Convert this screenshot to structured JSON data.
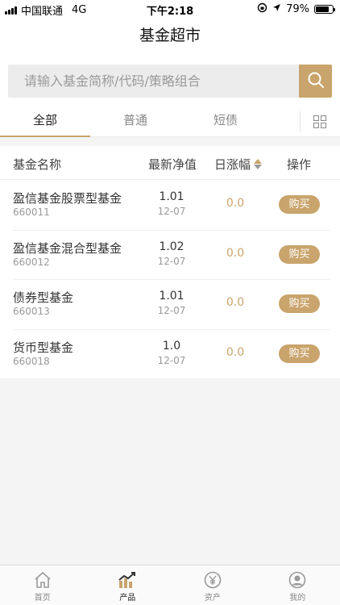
{
  "status_bar": {
    "carrier": "中国联通",
    "network": "4G",
    "time": "下午2:18",
    "battery": "79%",
    "battery_level": 0.79
  },
  "nav": {
    "title": "基金超市"
  },
  "search": {
    "placeholder": "请输入基金简称/代码/策略组合",
    "icon": "search-icon",
    "accent": "#c9a46c"
  },
  "tabs": [
    {
      "label": "全部",
      "active": true
    },
    {
      "label": "普通",
      "active": false
    },
    {
      "label": "短债",
      "active": false
    }
  ],
  "grid_icon": "grid-icon",
  "table": {
    "headers": {
      "name": "基金名称",
      "nav": "最新净值",
      "change": "日涨幅",
      "operation": "操作"
    },
    "rows": [
      {
        "name": "盈信基金股票型基金",
        "code": "660011",
        "nav": "1.01",
        "date": "12-07",
        "change": "0.0",
        "action": "购买"
      },
      {
        "name": "盈信基金混合型基金",
        "code": "660012",
        "nav": "1.02",
        "date": "12-07",
        "change": "0.0",
        "action": "购买"
      },
      {
        "name": "债券型基金",
        "code": "660013",
        "nav": "1.01",
        "date": "12-07",
        "change": "0.0",
        "action": "购买"
      },
      {
        "name": "货币型基金",
        "code": "660018",
        "nav": "1.0",
        "date": "12-07",
        "change": "0.0",
        "action": "购买"
      }
    ]
  },
  "tabbar": [
    {
      "label": "首页",
      "icon": "home-icon",
      "active": false
    },
    {
      "label": "产品",
      "icon": "chart-icon",
      "active": true
    },
    {
      "label": "资产",
      "icon": "yen-coin-icon",
      "active": false
    },
    {
      "label": "我的",
      "icon": "user-icon",
      "active": false
    }
  ],
  "colors": {
    "accent": "#c9a46c",
    "background": "#f4f4f4"
  }
}
